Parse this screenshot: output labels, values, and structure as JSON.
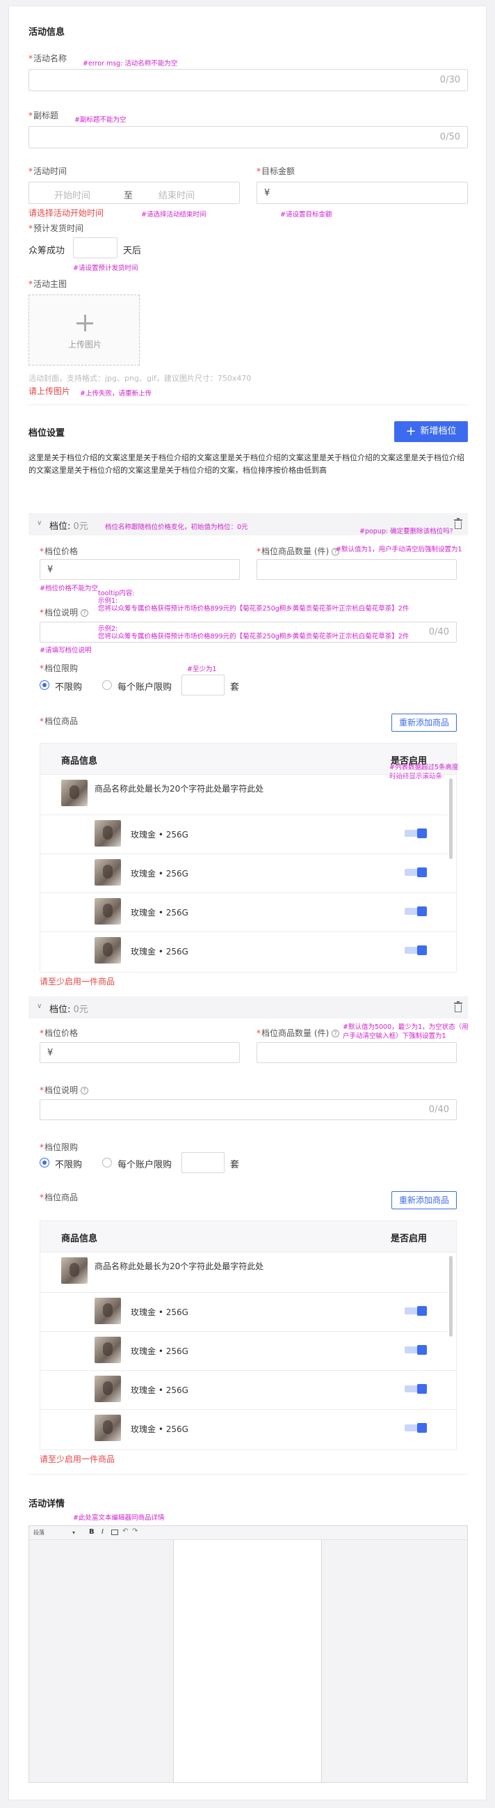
{
  "section_info": {
    "title": "活动信息",
    "name_label": "活动名称",
    "name_note": "#error msg: 活动名称不能为空",
    "name_counter": "0/30",
    "subtitle_label": "副标题",
    "subtitle_note": "#副标题不能为空",
    "subtitle_counter": "0/50",
    "time_label": "活动时间",
    "start_placeholder": "开始时间",
    "to_text": "至",
    "end_placeholder": "结束时间",
    "time_error": "请选择活动开始时间",
    "time_note": "#请选择活动结束时间",
    "target_label": "目标金额",
    "currency": "¥",
    "target_note": "#请设置目标金额",
    "ship_label": "预计发货时间",
    "ship_prefix": "众筹成功",
    "ship_suffix": "天后",
    "ship_note": "#请设置预计发货时间",
    "image_label": "活动主图",
    "upload_text": "上传图片",
    "image_hint": "活动封面，支持格式：jpg、png、gif，建议图片尺寸：750x470",
    "image_error": "请上传图片",
    "image_note": "#上传失败，请重新上传"
  },
  "tiers_section": {
    "title": "档位设置",
    "add_button": "新增档位",
    "intro": "这里是关于档位介绍的文案这里是关于档位介绍的文案这里是关于档位介绍的文案这里是关于档位介绍的文案这里是关于档位介绍的文案这里是关于档位介绍的文案这里是关于档位介绍的文案，档位排序按价格由低到高"
  },
  "tier1": {
    "header": "档位:",
    "price_display": "0元",
    "header_note": "档位名称跟随档位价格变化，初始值为档位：0元",
    "delete_note": "#popup: 确定要删除该档位吗?",
    "price_label": "档位价格",
    "currency": "¥",
    "price_note": "#档位价格不能为空",
    "qty_label": "档位商品数量 (件)",
    "qty_note": "#默认值为1，用户手动清空后强制设置为1",
    "desc_label": "档位说明",
    "tooltip_title": "tooltip内容:",
    "tooltip_ex1": "示例1:",
    "tooltip_line1": "您将以众筹专属价格获得预计市场价格899元的【菊花茶250g桐乡黄菊贡菊花茶叶正宗杭白菊花草茶】2件",
    "tooltip_ex2": "示例2:",
    "tooltip_line2": "您将以众筹专属价格获得预计市场价格899元的【菊花茶250g桐乡黄菊贡菊花茶叶正宗杭白菊花草茶】2件",
    "desc_counter": "0/40",
    "desc_note": "#请填写档位说明",
    "limit_label": "档位限购",
    "limit_note": "#至少为1",
    "limit_unlimited": "不限购",
    "limit_per_account": "每个账户限购",
    "limit_unit": "套",
    "goods_label": "档位商品",
    "readd_button": "重新添加商品",
    "col_info": "商品信息",
    "col_enabled": "是否启用",
    "scroll_note1": "#列表数据超过5条高度",
    "scroll_note2": "时始终显示滚动条",
    "product_name": "商品名称此处最长为20个字符此处最字符此处",
    "skus": [
      "玫瑰金 • 256G",
      "玫瑰金 • 256G",
      "玫瑰金 • 256G",
      "玫瑰金 • 256G"
    ],
    "goods_error": "请至少启用一件商品"
  },
  "tier2": {
    "header": "档位:",
    "price_display": "0元",
    "price_label": "档位价格",
    "currency": "¥",
    "qty_label": "档位商品数量 (件)",
    "qty_note1": "#默认值为5000，最少为1，为空状态（用",
    "qty_note2": "户手动清空输入框）下强制设置为1",
    "desc_label": "档位说明",
    "desc_counter": "0/40",
    "limit_label": "档位限购",
    "limit_unlimited": "不限购",
    "limit_per_account": "每个账户限购",
    "limit_unit": "套",
    "goods_label": "档位商品",
    "readd_button": "重新添加商品",
    "col_info": "商品信息",
    "col_enabled": "是否启用",
    "product_name": "商品名称此处最长为20个字符此处最字符此处",
    "skus": [
      "玫瑰金 • 256G",
      "玫瑰金 • 256G",
      "玫瑰金 • 256G",
      "玫瑰金 • 256G"
    ],
    "goods_error": "请至少启用一件商品"
  },
  "details": {
    "title": "活动详情",
    "note": "#此处富文本编辑器同商品详情",
    "toolbar_format": "段落",
    "bold": "B",
    "italic": "I",
    "undo": "↶",
    "redo": "↷"
  },
  "colors": {
    "accent": "#3d6bf0",
    "error": "#e64545",
    "annotation": "#d020d0"
  }
}
